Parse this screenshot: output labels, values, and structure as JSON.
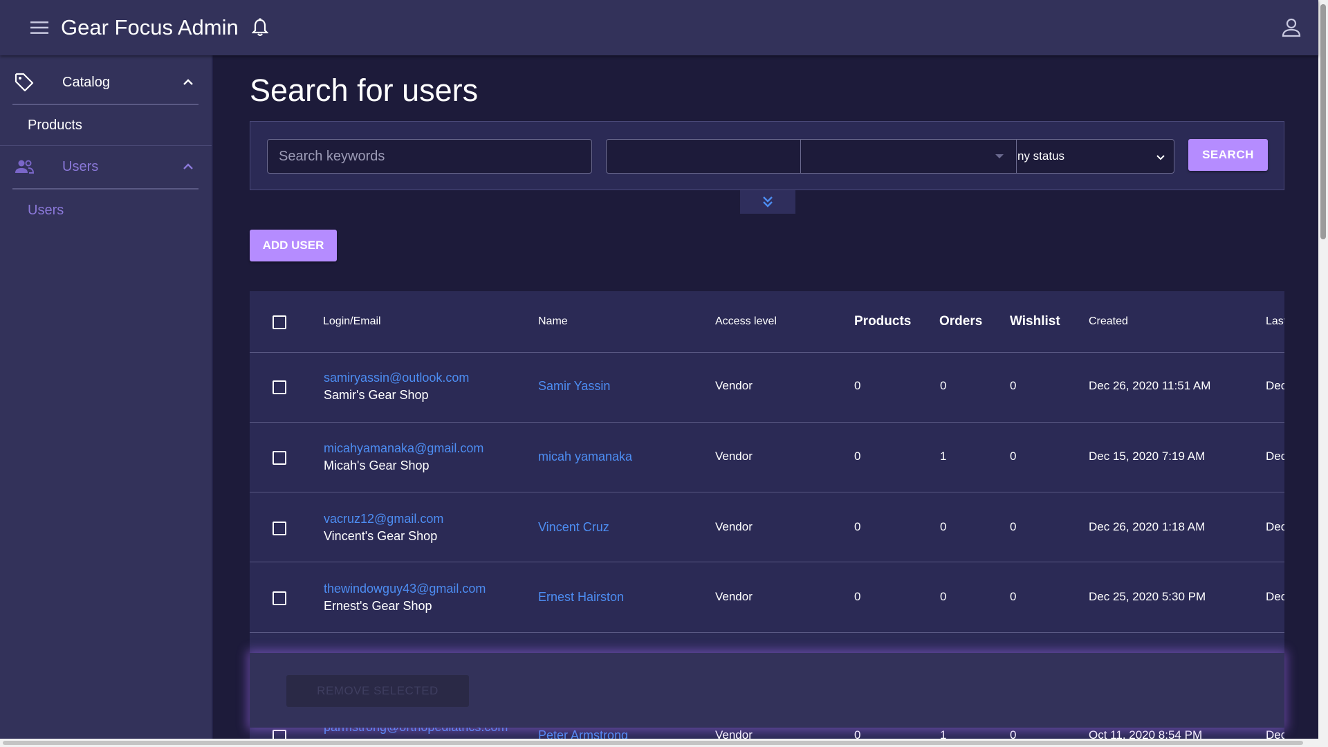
{
  "header": {
    "title": "Gear Focus Admin",
    "menu_icon": "menu-icon",
    "bell_icon": "bell-icon",
    "account_icon": "account-icon"
  },
  "sidebar": {
    "sections": [
      {
        "label": "Catalog",
        "icon": "tag-icon",
        "expanded": true,
        "items": [
          {
            "label": "Products"
          }
        ]
      },
      {
        "label": "Users",
        "icon": "people-icon",
        "expanded": true,
        "items": [
          {
            "label": "Users"
          }
        ]
      }
    ]
  },
  "main": {
    "page_title": "Search for users",
    "search": {
      "placeholder": "Search keywords",
      "status_value": "ny status",
      "search_label": "SEARCH"
    },
    "add_user_label": "ADD USER",
    "table": {
      "headers": {
        "login": "Login/Email",
        "name": "Name",
        "access": "Access level",
        "products": "Products",
        "orders": "Orders",
        "wishlist": "Wishlist",
        "created": "Created",
        "last": "Last"
      },
      "rows": [
        {
          "email": "samiryassin@outlook.com",
          "shop": "Samir's Gear Shop",
          "name": "Samir Yassin",
          "access": "Vendor",
          "products": "0",
          "orders": "0",
          "wishlist": "0",
          "created": "Dec 26, 2020 11:51 AM",
          "last": "Dec"
        },
        {
          "email": "micahyamanaka@gmail.com",
          "shop": "Micah's Gear Shop",
          "name": "micah yamanaka",
          "access": "Vendor",
          "products": "0",
          "orders": "1",
          "wishlist": "0",
          "created": "Dec 15, 2020 7:19 AM",
          "last": "Dec"
        },
        {
          "email": "vacruz12@gmail.com",
          "shop": "Vincent's Gear Shop",
          "name": "Vincent Cruz",
          "access": "Vendor",
          "products": "0",
          "orders": "0",
          "wishlist": "0",
          "created": "Dec 26, 2020 1:18 AM",
          "last": "Dec"
        },
        {
          "email": "thewindowguy43@gmail.com",
          "shop": "Ernest's Gear Shop",
          "name": "Ernest Hairston",
          "access": "Vendor",
          "products": "0",
          "orders": "0",
          "wishlist": "0",
          "created": "Dec 25, 2020 5:30 PM",
          "last": "Dec"
        },
        {
          "email": "parmstrong@orthopediatrics.com",
          "shop": "",
          "name": "Peter Armstrong",
          "access": "Vendor",
          "products": "0",
          "orders": "1",
          "wishlist": "0",
          "created": "Oct 11, 2020 8:54 PM",
          "last": "Dec"
        }
      ]
    },
    "remove_selected_label": "REMOVE SELECTED"
  },
  "colors": {
    "background": "#1d1b3a",
    "panel": "#33325a",
    "accent": "#b58cff",
    "link": "#4d8df2"
  }
}
